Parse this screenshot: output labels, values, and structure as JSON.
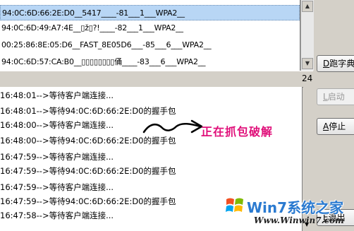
{
  "ap_list": {
    "rows": [
      {
        "text": "94:0C:6D:66:2E:D0__5417____-81___1___WPA2__",
        "selected": true
      },
      {
        "text": "94:0C:6D:49:A7:4E__▯ž▯?!____-82___1___WPA2__",
        "selected": false
      },
      {
        "text": "00:25:86:8E:05:D6__FAST_8E05D6___-85___6___WPA2__",
        "selected": false
      },
      {
        "text": "94:0C:6D:57:CA:B0__▯▯▯▯▯▯▯▯俑____-83___6___WPA2__",
        "selected": false
      }
    ]
  },
  "count": "24",
  "log_rows": [
    "16:48:01-->等待客户端连接...",
    "16:48:01-->等待94:0C:6D:66:2E:D0的握手包",
    "16:48:00-->等待客户端连接...",
    "16:48:00-->等待94:0C:6D:66:2E:D0的握手包",
    "16:47:59-->等待客户端连接...",
    "16:47:59-->等待94:0C:6D:66:2E:D0的握手包",
    "16:47:59-->等待客户端连接...",
    "16:47:59-->等待94:0C:6D:66:2E:D0的握手包",
    "16:47:58-->等待客户端连接..."
  ],
  "annotation": "正在抓包破解",
  "buttons": {
    "dictionary": {
      "key": "D",
      "label": "跑字典"
    },
    "start": {
      "key": "L",
      "label": "启动"
    },
    "stop": {
      "key": "A",
      "label": "停止"
    },
    "exit": {
      "key": "E",
      "label": "退出"
    }
  },
  "watermark": {
    "title": "Win7系统之家",
    "url": "Www.Winwin7.com"
  },
  "colors": {
    "selected_row": "#b8d6f5",
    "annotation": "#e0107a",
    "watermark": "#2a7ad0"
  }
}
